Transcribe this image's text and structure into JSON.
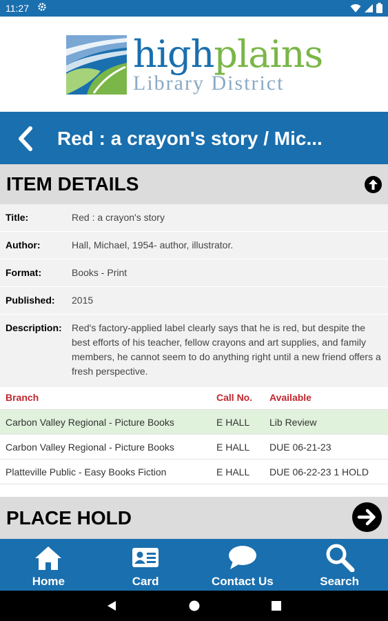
{
  "status_bar": {
    "time": "11:27",
    "icons": [
      "gear-icon",
      "wifi-icon",
      "signal-icon",
      "battery-icon"
    ]
  },
  "logo": {
    "word1": "high",
    "word2": "plains",
    "subtitle": "Library District"
  },
  "header": {
    "title": "Red : a crayon's story / Mic..."
  },
  "item_details": {
    "heading": "ITEM DETAILS",
    "rows": [
      {
        "label": "Title:",
        "value": "Red : a crayon's story"
      },
      {
        "label": "Author:",
        "value": "Hall, Michael, 1954- author, illustrator."
      },
      {
        "label": "Format:",
        "value": "Books - Print"
      },
      {
        "label": "Published:",
        "value": "2015"
      },
      {
        "label": "Description:",
        "value": "Red's factory-applied label clearly says that he is red, but despite the best efforts of his teacher, fellow crayons and art supplies, and family members, he cannot seem to do anything right until a new friend offers a fresh perspective."
      }
    ]
  },
  "holdings": {
    "columns": [
      "Branch",
      "Call No.",
      "Available"
    ],
    "rows": [
      {
        "branch": "Carbon Valley Regional - Picture Books",
        "call_no": "E HALL",
        "available": "Lib Review"
      },
      {
        "branch": "Carbon Valley Regional - Picture Books",
        "call_no": "E HALL",
        "available": "DUE 06-21-23"
      },
      {
        "branch": "Platteville Public - Easy Books Fiction",
        "call_no": "E HALL",
        "available": "DUE 06-22-23 1 HOLD"
      }
    ]
  },
  "place_hold": {
    "heading": "PLACE HOLD"
  },
  "bottom_nav": [
    {
      "label": "Home",
      "icon": "home-icon"
    },
    {
      "label": "Card",
      "icon": "card-icon"
    },
    {
      "label": "Contact Us",
      "icon": "chat-icon"
    },
    {
      "label": "Search",
      "icon": "search-icon"
    }
  ],
  "colors": {
    "brand_blue": "#1a6fae",
    "brand_green": "#7ab648",
    "column_header_red": "#c0262d",
    "highlight_green": "#e0f1dc"
  }
}
